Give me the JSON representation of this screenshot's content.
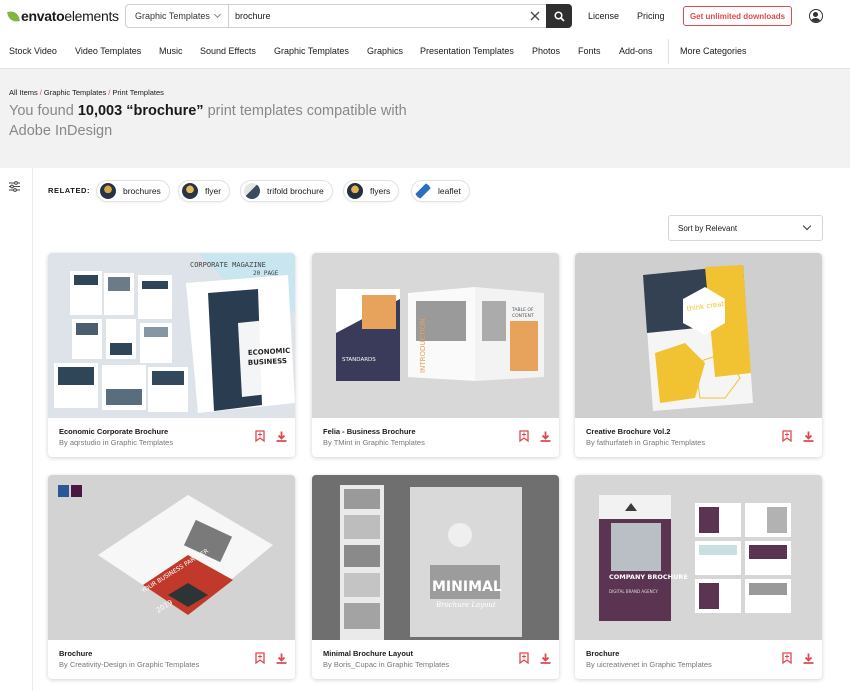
{
  "header": {
    "logo_bold": "envato",
    "logo_light": "elements",
    "search_category": "Graphic Templates",
    "search_value": "brochure",
    "links": [
      "License",
      "Pricing"
    ],
    "cta": "Get unlimited downloads"
  },
  "nav": [
    "Stock Video",
    "Video Templates",
    "Music",
    "Sound Effects",
    "Graphic Templates",
    "Graphics",
    "Presentation Templates",
    "Photos",
    "Fonts",
    "Add-ons",
    "More Categories"
  ],
  "breadcrumbs": [
    "All Items",
    "Graphic Templates",
    "Print Templates"
  ],
  "headline": {
    "prefix": "You found",
    "count": "10,003",
    "query": "“brochure”",
    "suffix": "print templates compatible with Adobe InDesign"
  },
  "related": {
    "label": "RELATED:",
    "chips": [
      "brochures",
      "flyer",
      "trifold brochure",
      "flyers",
      "leaflet"
    ]
  },
  "sort": "Sort by Relevant",
  "cards": [
    {
      "title": "Economic Corporate Brochure",
      "byline": "By aqrstudio in Graphic Templates",
      "cover_text": "CORPORATE MAGAZINE",
      "cover_sub": "20 PAGE",
      "cover_big": "ECONOMIC BUSINESS"
    },
    {
      "title": "Felia - Business Brochure",
      "byline": "By TMint in Graphic Templates",
      "cover_text": "STANDARDS",
      "cover_sub": "INTRODUCTION",
      "cover_big": "TABLE OF CONTENT"
    },
    {
      "title": "Creative Brochure Vol.2",
      "byline": "By fathurfateh in Graphic Templates",
      "cover_text": "think creative"
    },
    {
      "title": "Brochure",
      "byline": "By Creativity-Design in Graphic Templates",
      "cover_text": "YOUR BUSINESS PARTNER",
      "cover_sub": "2019"
    },
    {
      "title": "Minimal Brochure Layout",
      "byline": "By Boris_Cupac in Graphic Templates",
      "cover_text": "MINIMAL",
      "cover_sub": "Brochure Layout"
    },
    {
      "title": "Brochure",
      "byline": "By uicreativenet in Graphic Templates",
      "cover_text": "COMPANY BROCHURE",
      "cover_sub": "DIGITAL BRAND AGENCY"
    }
  ],
  "colors": {
    "brand_green": "#82b541",
    "accent_red": "#e0484d",
    "dark": "#2f2f2f"
  },
  "icons": [
    "search-icon",
    "close-icon",
    "user-icon",
    "filter-icon",
    "bookmark-icon",
    "download-icon",
    "chevron-down-icon"
  ]
}
